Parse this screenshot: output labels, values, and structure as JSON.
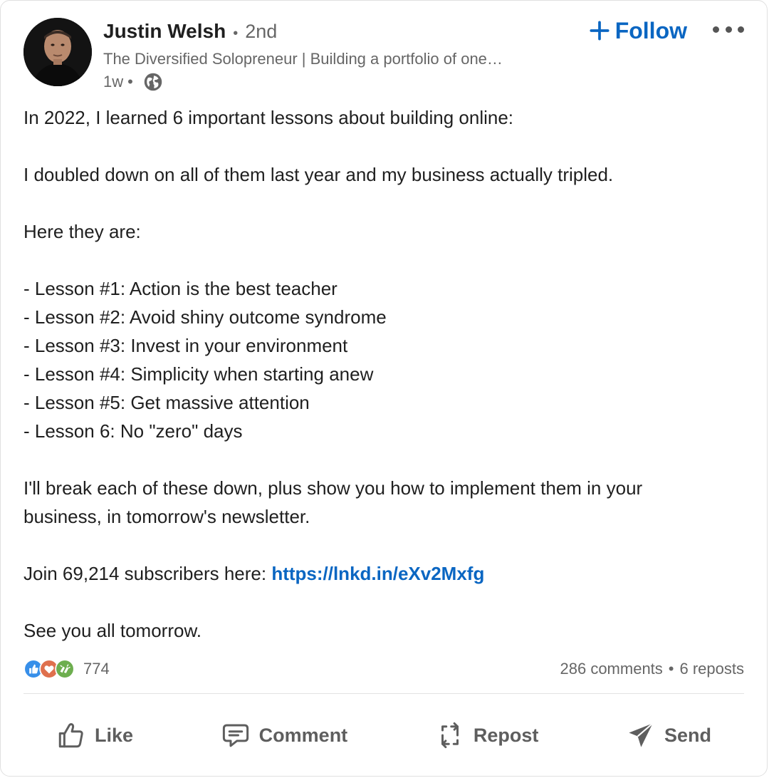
{
  "post": {
    "author": {
      "name": "Justin Welsh",
      "degree": "2nd",
      "headline": "The Diversified Solopreneur | Building a portfolio of one…",
      "time": "1w"
    },
    "follow_label": "Follow",
    "body": [
      "In 2022, I learned 6 important lessons about building online:",
      "",
      "I doubled down on all of them last year and my business actually tripled.",
      "",
      "Here they are:",
      "",
      "- Lesson #1: Action is the best teacher",
      "- Lesson #2: Avoid shiny outcome syndrome",
      "- Lesson #3: Invest in your environment",
      "- Lesson #4: Simplicity when starting anew",
      "- Lesson #5: Get massive attention",
      "- Lesson 6: No \"zero\" days",
      "",
      "I'll break each of these down, plus show you how to implement them in your",
      "business, in tomorrow's newsletter.",
      ""
    ],
    "join_prefix": "Join 69,214 subscribers here: ",
    "join_link": "https://lnkd.in/eXv2Mxfg",
    "closing": "See you all tomorrow.",
    "stats": {
      "reactions_count": "774",
      "comments": "286 comments",
      "separator": "•",
      "reposts": "6 reposts"
    },
    "actions": {
      "like": "Like",
      "comment": "Comment",
      "repost": "Repost",
      "send": "Send"
    }
  },
  "colors": {
    "accent": "#0a66c2",
    "muted_text": "#666666",
    "like_blue": "#378fe9",
    "love_red": "#df704d",
    "celebrate_green": "#44712e"
  },
  "icons": [
    "avatar",
    "globe-icon",
    "plus-icon",
    "more-icon",
    "like-reaction-icon",
    "love-reaction-icon",
    "celebrate-reaction-icon",
    "thumbs-up-icon",
    "comment-icon",
    "repost-icon",
    "send-icon"
  ]
}
